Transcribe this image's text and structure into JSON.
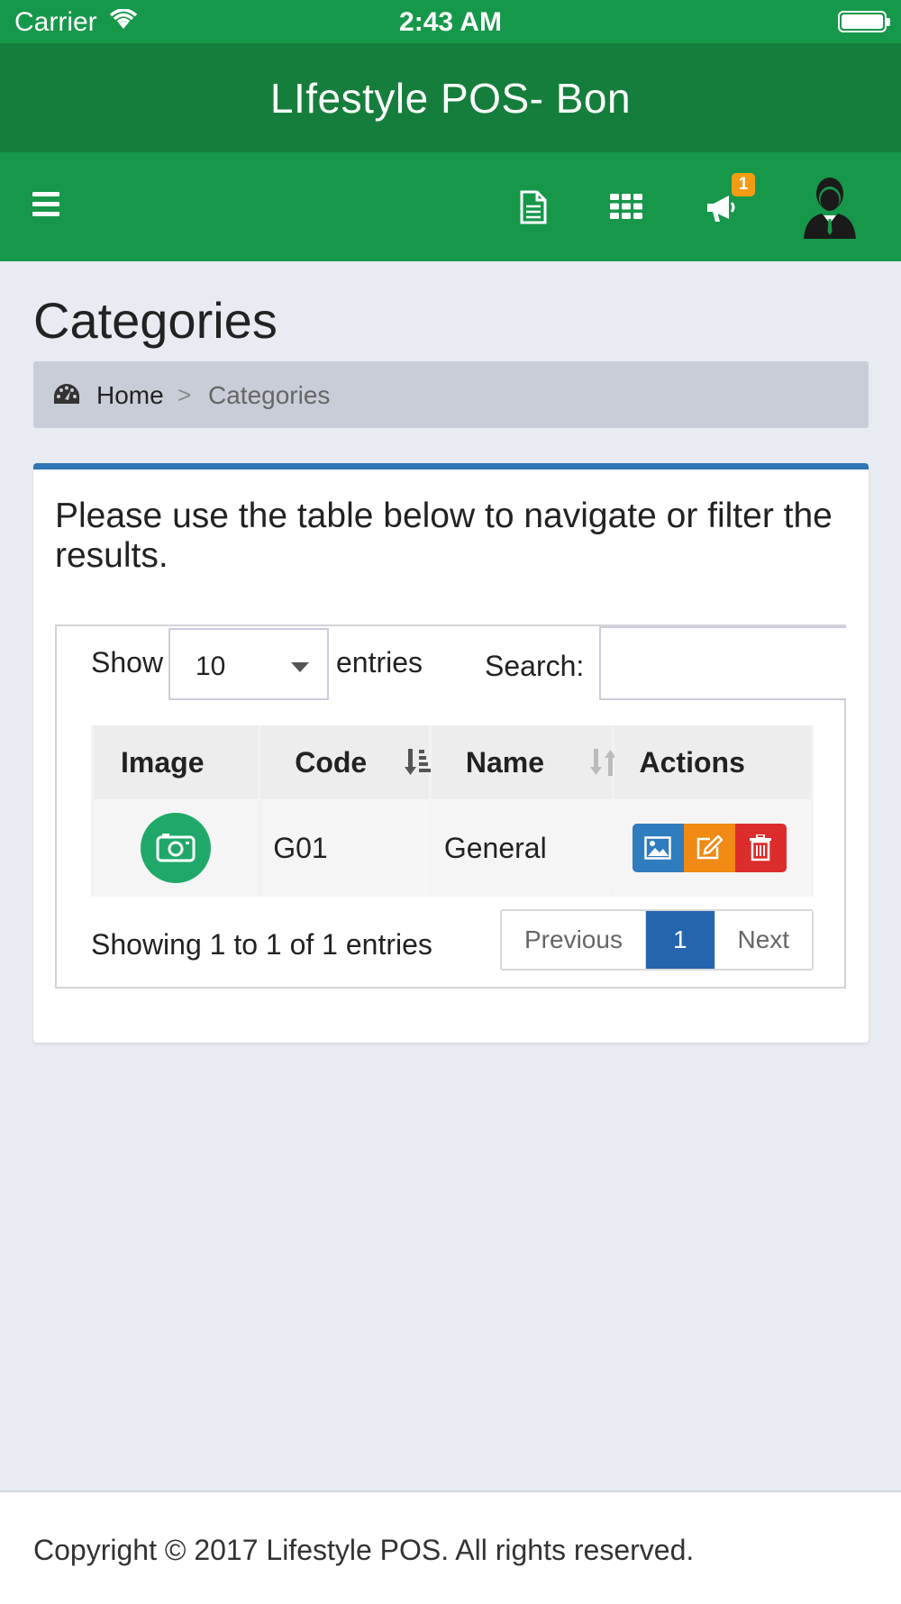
{
  "status_bar": {
    "carrier": "Carrier",
    "time": "2:43 AM"
  },
  "header": {
    "title": "LIfestyle POS- Bon"
  },
  "navbar": {
    "notification_count": "1",
    "icons": [
      "menu-icon",
      "document-icon",
      "grid-icon",
      "megaphone-icon",
      "user-avatar-icon"
    ]
  },
  "page": {
    "title": "Categories",
    "breadcrumb": {
      "home": "Home",
      "separator": ">",
      "current": "Categories"
    }
  },
  "box": {
    "intro": "Please use the table below to navigate or filter the results.",
    "length": {
      "before": "Show",
      "value": "10",
      "after": "entries"
    },
    "search": {
      "label": "Search:",
      "value": ""
    },
    "table": {
      "columns": [
        "Image",
        "Code",
        "Name",
        "Actions"
      ],
      "rows": [
        {
          "code": "G01",
          "name": "General"
        }
      ]
    },
    "info": "Showing 1 to 1 of 1 entries",
    "pagination": {
      "previous": "Previous",
      "current": "1",
      "next": "Next"
    }
  },
  "footer": {
    "text": "Copyright © 2017 Lifestyle POS. All rights reserved."
  },
  "colors": {
    "status_bar": "#16984a",
    "header": "#157e3c",
    "navbar": "#17974a",
    "box_accent": "#2f74b5",
    "page_active": "#2565ae",
    "badge": "#f39c12"
  }
}
